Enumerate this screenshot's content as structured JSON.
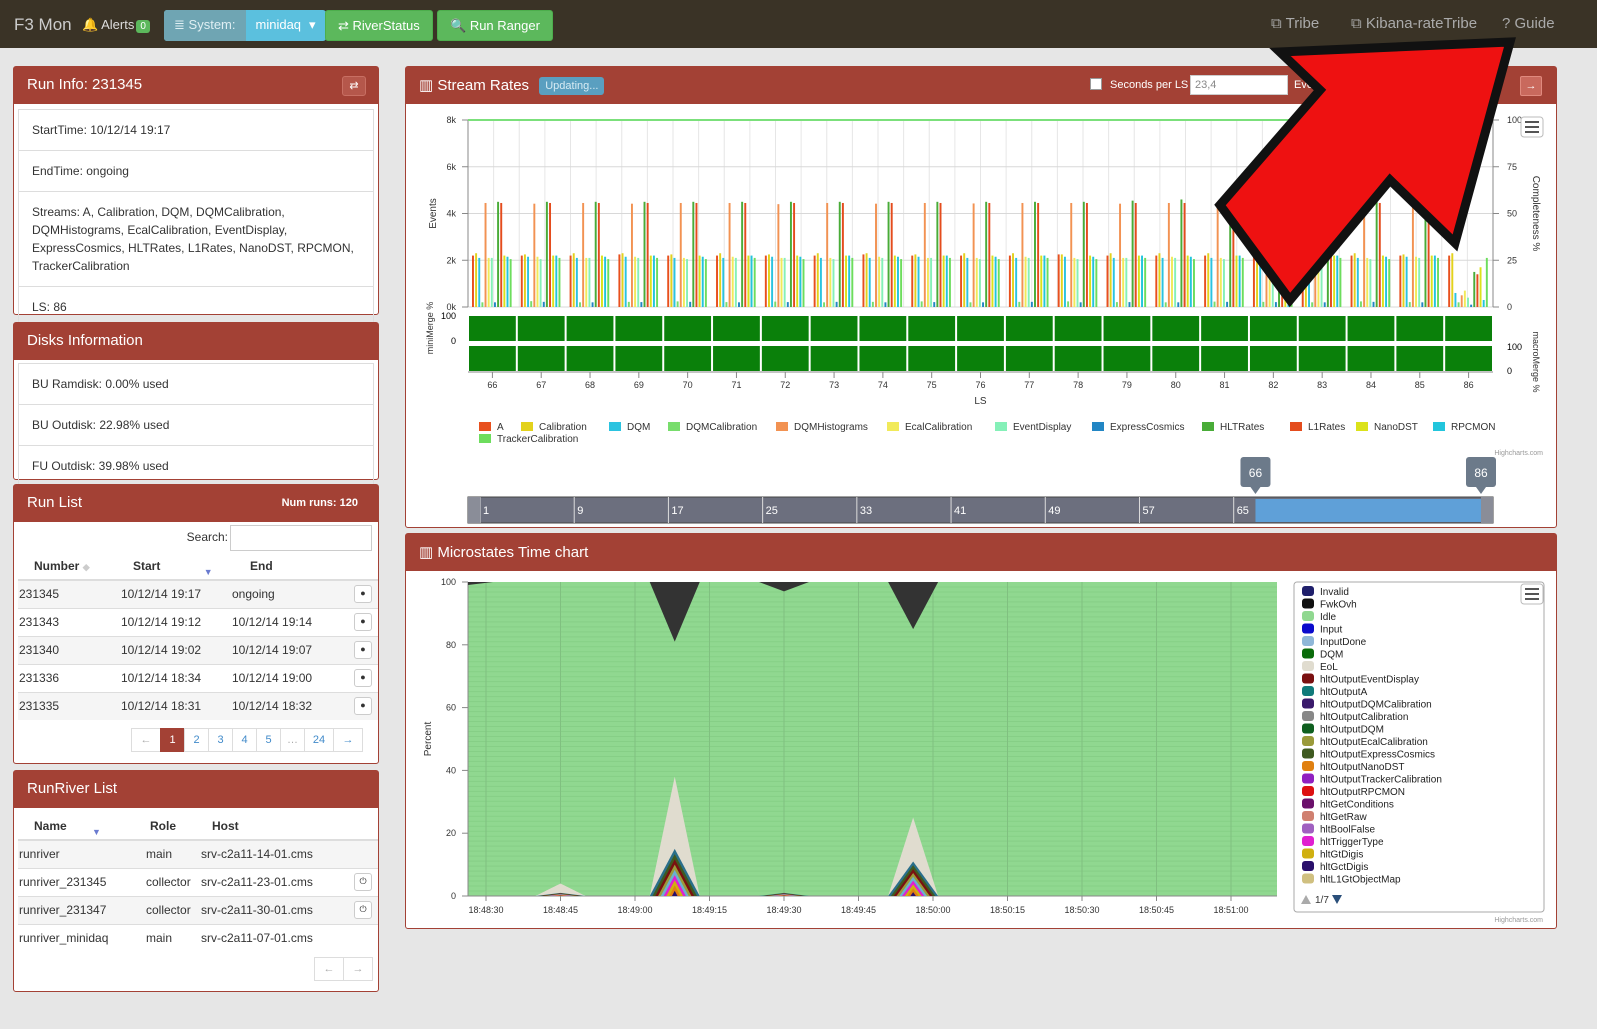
{
  "topbar": {
    "brand": "F3 Mon",
    "alerts_label": "Alerts",
    "alerts_count": "0",
    "system_label": "System:",
    "system_value": "minidaq",
    "riverstatus": "RiverStatus",
    "runranger": "Run Ranger",
    "tribe": "Tribe",
    "kibana": "Kibana-rateTribe",
    "guide": "Guide"
  },
  "runinfo": {
    "title": "Run Info: 231345",
    "start": "StartTime: 10/12/14 19:17",
    "end": "EndTime: ongoing",
    "streams": "Streams: A, Calibration, DQM, DQMCalibration, DQMHistograms, EcalCalibration, EventDisplay, ExpressCosmics, HLTRates, L1Rates, NanoDST, RPCMON, TrackerCalibration",
    "ls": "LS: 86"
  },
  "disks": {
    "title": "Disks Information",
    "bu_ramdisk": "BU Ramdisk: 0.00% used",
    "bu_outdisk": "BU Outdisk: 22.98% used",
    "fu_outdisk": "FU Outdisk: 39.98% used"
  },
  "runlist": {
    "title": "Run List",
    "numruns": "Num runs: 120",
    "search_label": "Search:",
    "headers": [
      "Number",
      "Start",
      "End"
    ],
    "rows": [
      [
        "231345",
        "10/12/14 19:17",
        "ongoing"
      ],
      [
        "231343",
        "10/12/14 19:12",
        "10/12/14 19:14"
      ],
      [
        "231340",
        "10/12/14 19:02",
        "10/12/14 19:07"
      ],
      [
        "231336",
        "10/12/14 18:34",
        "10/12/14 19:00"
      ],
      [
        "231335",
        "10/12/14 18:31",
        "10/12/14 18:32"
      ]
    ],
    "pages": [
      "←",
      "1",
      "2",
      "3",
      "4",
      "5",
      "…",
      "24",
      "→"
    ]
  },
  "riverlist": {
    "title": "RunRiver List",
    "headers": [
      "Name",
      "Role",
      "Host"
    ],
    "rows": [
      [
        "runriver",
        "main",
        "srv-c2a11-14-01.cms"
      ],
      [
        "runriver_231345",
        "collector",
        "srv-c2a11-23-01.cms"
      ],
      [
        "runriver_231347",
        "collector",
        "srv-c2a11-30-01.cms"
      ],
      [
        "runriver_minidaq",
        "main",
        "srv-c2a11-07-01.cms"
      ]
    ],
    "pages": [
      "←",
      "→"
    ]
  },
  "streamrates": {
    "title": "Stream Rates",
    "updating": "Updating...",
    "seconds_label": "Seconds per LS",
    "seconds_value": "23,4",
    "events_label": "Events",
    "credit": "Highcharts.com"
  },
  "microstates": {
    "title": "Microstates Time chart",
    "credit": "Highcharts.com",
    "legend_page": "1/7",
    "legend": [
      {
        "name": "Invalid",
        "color": "#1f1f6b"
      },
      {
        "name": "FwkOvh",
        "color": "#111111"
      },
      {
        "name": "Idle",
        "color": "#90d890"
      },
      {
        "name": "Input",
        "color": "#0a0acc"
      },
      {
        "name": "InputDone",
        "color": "#8fb7d8"
      },
      {
        "name": "DQM",
        "color": "#0a6b0a"
      },
      {
        "name": "EoL",
        "color": "#e0dccf"
      },
      {
        "name": "hltOutputEventDisplay",
        "color": "#7a1010"
      },
      {
        "name": "hltOutputA",
        "color": "#107a7a"
      },
      {
        "name": "hltOutputDQMCalibration",
        "color": "#3a1a6b"
      },
      {
        "name": "hltOutputCalibration",
        "color": "#888888"
      },
      {
        "name": "hltOutputDQM",
        "color": "#0f5f1f"
      },
      {
        "name": "hltOutputEcalCalibration",
        "color": "#9a9a3a"
      },
      {
        "name": "hltOutputExpressCosmics",
        "color": "#3f5a20"
      },
      {
        "name": "hltOutputNanoDST",
        "color": "#e08010"
      },
      {
        "name": "hltOutputTrackerCalibration",
        "color": "#9020c0"
      },
      {
        "name": "hltOutputRPCMON",
        "color": "#dd1111"
      },
      {
        "name": "hltGetConditions",
        "color": "#6b106b"
      },
      {
        "name": "hltGetRaw",
        "color": "#d08070"
      },
      {
        "name": "hltBoolFalse",
        "color": "#a060c0"
      },
      {
        "name": "hltTriggerType",
        "color": "#e020d0"
      },
      {
        "name": "hltGtDigis",
        "color": "#d0b010"
      },
      {
        "name": "hltGctDigis",
        "color": "#2a106b"
      },
      {
        "name": "hltL1GtObjectMap",
        "color": "#d0c080"
      }
    ]
  },
  "chart_data": [
    {
      "type": "bar",
      "title": "",
      "xlabel": "LS",
      "ylabel": "Events",
      "ylim": [
        0,
        8000
      ],
      "y2label": "Completeness %",
      "y2lim": [
        0,
        100
      ],
      "yticks": [
        "8k",
        "6k",
        "4k",
        "2k",
        "0k"
      ],
      "y2ticks": [
        "100",
        "75",
        "50",
        "25",
        "0"
      ],
      "categories": [
        66,
        67,
        68,
        69,
        70,
        71,
        72,
        73,
        74,
        75,
        76,
        77,
        78,
        79,
        80,
        81,
        82,
        83,
        84,
        85,
        86
      ],
      "series": [
        {
          "name": "A",
          "color": "#e8501e",
          "values": [
            2200,
            2200,
            2200,
            2250,
            2200,
            2200,
            2200,
            2200,
            2250,
            2200,
            2200,
            2200,
            2250,
            2200,
            2200,
            2200,
            2200,
            2200,
            2200,
            2200,
            2200
          ]
        },
        {
          "name": "Calibration",
          "color": "#e3d21c",
          "values": [
            2300,
            2250,
            2300,
            2300,
            2250,
            2300,
            2250,
            2300,
            2300,
            2250,
            2300,
            2300,
            2250,
            2300,
            2300,
            2300,
            2250,
            2300,
            2300,
            2250,
            2300
          ]
        },
        {
          "name": "DQM",
          "color": "#2bc3e0",
          "values": [
            2100,
            2150,
            2100,
            2150,
            2100,
            2100,
            2150,
            2100,
            2100,
            2150,
            2100,
            2100,
            2150,
            2100,
            2100,
            2100,
            2150,
            2100,
            2100,
            2150,
            600
          ]
        },
        {
          "name": "DQMCalibration",
          "color": "#78dd6c",
          "values": [
            200,
            250,
            200,
            220,
            240,
            210,
            230,
            200,
            220,
            240,
            200,
            220,
            240,
            210,
            200,
            230,
            220,
            200,
            240,
            210,
            200
          ]
        },
        {
          "name": "DQMHistograms",
          "color": "#f29252",
          "values": [
            4450,
            4420,
            4450,
            4420,
            4450,
            4450,
            4400,
            4450,
            4420,
            4450,
            4430,
            4450,
            4450,
            4420,
            4450,
            4450,
            4420,
            4450,
            4430,
            4450,
            500
          ]
        },
        {
          "name": "EcalCalibration",
          "color": "#f1ea5a",
          "values": [
            2100,
            2150,
            2100,
            2150,
            2100,
            2150,
            2100,
            2100,
            2150,
            2100,
            2100,
            2150,
            2100,
            2100,
            2150,
            2100,
            2150,
            2100,
            2100,
            2150,
            700
          ]
        },
        {
          "name": "EventDisplay",
          "color": "#85f0b8",
          "values": [
            2100,
            2050,
            2100,
            2100,
            2050,
            2100,
            2100,
            2050,
            2100,
            2100,
            2050,
            2100,
            2050,
            2100,
            2100,
            2050,
            2100,
            2100,
            2050,
            2100,
            400
          ]
        },
        {
          "name": "ExpressCosmics",
          "color": "#2286c4",
          "values": [
            200,
            220,
            200,
            210,
            220,
            200,
            210,
            220,
            200,
            210,
            200,
            220,
            200,
            210,
            200,
            220,
            210,
            200,
            220,
            200,
            100
          ]
        },
        {
          "name": "HLTRates",
          "color": "#49ac38",
          "values": [
            4500,
            4500,
            4500,
            4500,
            4500,
            4500,
            4500,
            4500,
            4500,
            4500,
            4500,
            4500,
            4500,
            4550,
            4600,
            4500,
            4500,
            4500,
            4500,
            4500,
            1500
          ]
        },
        {
          "name": "L1Rates",
          "color": "#e44c1d",
          "values": [
            4450,
            4450,
            4450,
            4450,
            4450,
            4450,
            4450,
            4450,
            4450,
            4450,
            4450,
            4450,
            4450,
            4450,
            4450,
            4450,
            4450,
            4450,
            4450,
            4450,
            1400
          ]
        },
        {
          "name": "NanoDST",
          "color": "#dbe21a",
          "values": [
            2200,
            2200,
            2200,
            2200,
            2200,
            2200,
            2200,
            2200,
            2200,
            2200,
            2200,
            2200,
            2200,
            2200,
            2200,
            2200,
            2200,
            2200,
            2200,
            2200,
            1700
          ]
        },
        {
          "name": "RPCMON",
          "color": "#22c5dc",
          "values": [
            2150,
            2200,
            2150,
            2200,
            2150,
            2200,
            2150,
            2200,
            2150,
            2200,
            2150,
            2200,
            2150,
            2200,
            2150,
            2200,
            2150,
            2200,
            2150,
            2200,
            300
          ]
        },
        {
          "name": "TrackerCalibration",
          "color": "#6ddd5d",
          "values": [
            2050,
            2100,
            2050,
            2100,
            2050,
            2100,
            2050,
            2100,
            2050,
            2100,
            2050,
            2100,
            2050,
            2100,
            2050,
            2100,
            2050,
            2100,
            2050,
            2100,
            2100
          ]
        }
      ],
      "completeness": 100,
      "minimerge": {
        "label": "miniMerge %",
        "ticks": [
          "100",
          "0"
        ],
        "values": [
          100,
          100,
          100,
          100,
          100,
          100,
          100,
          100,
          100,
          100,
          100,
          100,
          100,
          100,
          100,
          100,
          100,
          100,
          100,
          100,
          100
        ]
      },
      "macromerge": {
        "label": "macroMerge %",
        "ticks": [
          "100",
          "0"
        ],
        "values": [
          100,
          100,
          100,
          100,
          100,
          100,
          100,
          100,
          100,
          100,
          100,
          100,
          100,
          100,
          100,
          100,
          100,
          100,
          100,
          100,
          100
        ]
      },
      "navigator": {
        "ticks": [
          "1",
          "9",
          "17",
          "25",
          "33",
          "41",
          "49",
          "57",
          "65"
        ],
        "range": [
          66,
          86
        ],
        "min": 1,
        "max": 86
      }
    },
    {
      "type": "area",
      "title": "",
      "xlabel": "",
      "ylabel": "Percent",
      "ylim": [
        0,
        100
      ],
      "yticks": [
        "100",
        "80",
        "60",
        "40",
        "20",
        "0"
      ],
      "xticks": [
        "18:48:30",
        "18:48:45",
        "18:49:00",
        "18:49:15",
        "18:49:30",
        "18:49:45",
        "18:50:00",
        "18:50:15",
        "18:50:30",
        "18:50:45",
        "18:51:00"
      ],
      "peaks": [
        {
          "time": "18:48:45",
          "eol": 4,
          "colored": 1
        },
        {
          "time": "18:49:08",
          "eol": 38,
          "colored": 15,
          "fwkovh": 19
        },
        {
          "time": "18:49:30",
          "eol": 0,
          "colored": 1,
          "fwkovh": 3
        },
        {
          "time": "18:49:56",
          "eol": 25,
          "colored": 11,
          "fwkovh": 15
        }
      ]
    }
  ]
}
